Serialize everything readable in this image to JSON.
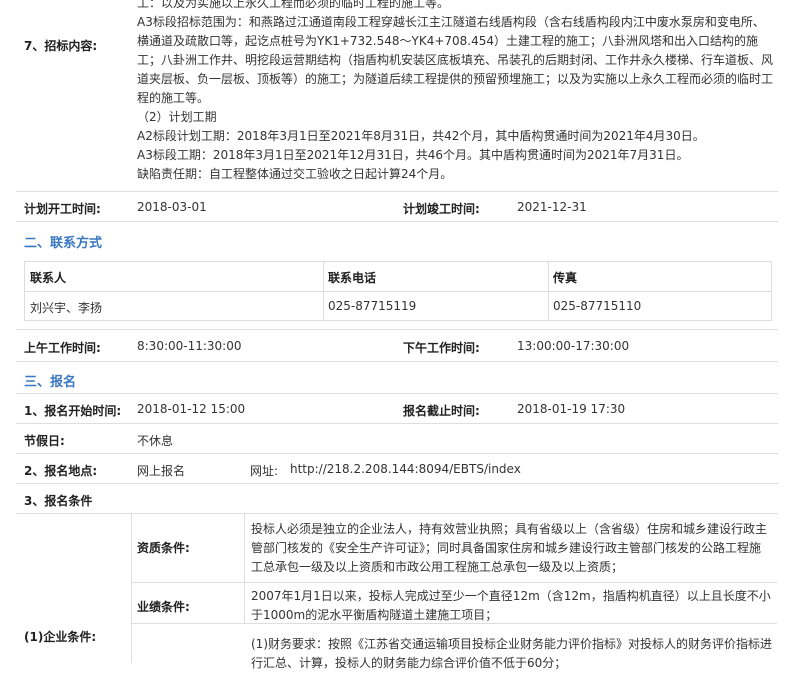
{
  "bidding": {
    "label": "7、招标内容:",
    "lines": [
      "工：以及为实施以上永久工程而必须的临时工程的施工等。",
      "A3标段招标范围为：和燕路过江通道南段工程穿越长江主江隧道右线盾构段（含右线盾构段内江中废水泵房和变电所、",
      "横通道及疏散口等，起讫点桩号为YK1+732.548～YK4+708.454）土建工程的施工；八卦洲风塔和出入口结构的施",
      "工；八卦洲工作井、明挖段运营期结构（指盾构机安装区底板填充、吊装孔的后期封闭、工作井永久楼梯、行车道板、风",
      "道夹层板、负一层板、顶板等）的施工；为隧道后续工程提供的预留预埋施工；以及为实施以上永久工程而必须的临时工",
      "程的施工等。",
      "（2）计划工期",
      "A2标段计划工期：2018年3月1日至2021年8月31日，共42个月，其中盾构贯通时间为2021年4月30日。",
      "A3标段工期：2018年3月1日至2021年12月31日，共46个月。其中盾构贯通时间为2021年7月31日。",
      "缺陷责任期：自工程整体通过交工验收之日起计算24个月。"
    ]
  },
  "schedule": {
    "start_label": "计划开工时间:",
    "start_value": "2018-03-01",
    "end_label": "计划竣工时间:",
    "end_value": "2021-12-31"
  },
  "contact": {
    "section_title": "二、联系方式",
    "headers": [
      "联系人",
      "联系电话",
      "传真"
    ],
    "row": [
      "刘兴宇、李扬",
      "025-87715119",
      "025-87715110"
    ]
  },
  "hours": {
    "am_label": "上午工作时间:",
    "am_value": "8:30:00-11:30:00",
    "pm_label": "下午工作时间:",
    "pm_value": "13:00:00-17:30:00"
  },
  "registration": {
    "section_title": "三、报名",
    "start_label": "1、报名开始时间:",
    "start_value": "2018-01-12 15:00",
    "end_label": "报名截止时间:",
    "end_value": "2018-01-19 17:30",
    "holiday_label": "节假日:",
    "holiday_value": "不休息",
    "place_label": "2、报名地点:",
    "place_value": "网上报名",
    "url_label": "网址:",
    "url_value": "http://218.2.208.144:8094/EBTS/index",
    "conditions_label": "3、报名条件"
  },
  "enterprise": {
    "label": "(1)企业条件:",
    "qualification_label": "资质条件:",
    "qualification_lines": [
      "投标人必须是独立的企业法人，持有效营业执照；具有省级以上（含省级）住房和城乡建设行政主",
      "管部门核发的《安全生产许可证》；同时具备国家住房和城乡建设行政主管部门核发的公路工程施",
      "工总承包一级及以上资质和市政公用工程施工总承包一级及以上资质；"
    ],
    "performance_label": "业绩条件:",
    "performance_lines": [
      "2007年1月1日以来，投标人完成过至少一个直径12m（含12m，指盾构机直径）以上且长度不小",
      "于1000m的泥水平衡盾构隧道土建施工项目；"
    ],
    "finance_lines": [
      "(1)财务要求：按照《江苏省交通运输项目投标企业财务能力评价指标》对投标人的财务评价指标进",
      "行汇总、计算，投标人的财务能力综合评价值不低于60分；"
    ]
  }
}
